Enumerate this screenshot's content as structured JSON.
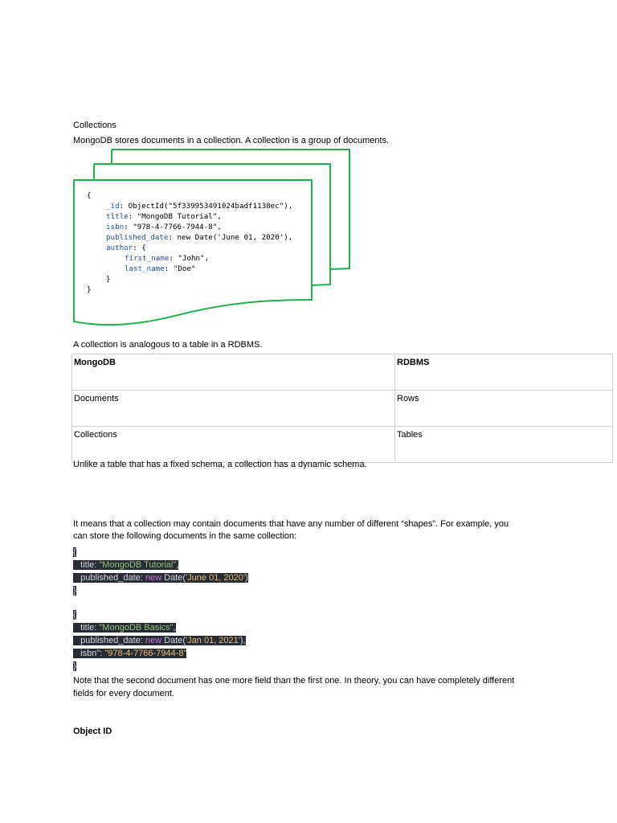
{
  "section1": {
    "heading": "Collections",
    "intro": "MongoDB stores documents in a collection. A collection is a group of documents."
  },
  "diagram": {
    "colors": {
      "border": "#22b14c",
      "key": "#1f4fb0"
    },
    "lines": [
      {
        "key": "{",
        "rest": ""
      },
      {
        "key": "_id",
        "rest": ": ObjectId(\"5f339953491024badf1138ec\"),"
      },
      {
        "key": "title",
        "rest": ": \"MongoDB Tutorial\","
      },
      {
        "key": "isbn",
        "rest": ": \"978-4-7766-7944-8\","
      },
      {
        "key": "published_date",
        "rest": ": new Date('June 01, 2020'),"
      },
      {
        "key": "author",
        "rest": ": {"
      },
      {
        "key": "first_name",
        "rest": ": \"John\","
      },
      {
        "key": "last_name",
        "rest": ": \"Doe\""
      },
      {
        "key": "}",
        "rest": ""
      },
      {
        "key": "}",
        "rest": ""
      }
    ]
  },
  "analogy_text": "A collection is analogous to a table in a RDBMS.",
  "table": {
    "headers": [
      "MongoDB",
      "RDBMS"
    ],
    "rows": [
      [
        "Documents",
        "Rows"
      ],
      [
        "Collections",
        "Tables"
      ]
    ]
  },
  "schema_text": "Unlike a table that has a fixed schema, a collection has a dynamic schema.",
  "shapes_text": {
    "line1": "It means that a collection may contain documents that have any number of different “shapes”. For example, you",
    "line2": "can store the following documents in the same collection:"
  },
  "code_block_1": {
    "open": "{",
    "title_key": "   title: ",
    "title_val": "\"MongoDB Tutorial\"",
    "title_end": ",",
    "date_key": "   published_date: ",
    "date_new": "new",
    "date_fn": " Date(",
    "date_val": "'June 01, 2020'",
    "date_end": ")",
    "close": "}"
  },
  "code_block_2": {
    "open": "{",
    "title_key": "   title: ",
    "title_val": "\"MongoDB Basics\"",
    "title_end": ",",
    "date_key": "   published_date: ",
    "date_new": "new",
    "date_fn": " Date(",
    "date_val": "'Jan 01, 2021'",
    "date_end": "),",
    "isbn_key": "   isbn\": ",
    "isbn_val": "\"978-4-7766-7944-8\"",
    "close": "}"
  },
  "note": {
    "line1": "Note that the second document has one more field than the first one. In theory, you can have completely different",
    "line2": "fields for every document."
  },
  "section2": {
    "heading": "Object ID"
  }
}
